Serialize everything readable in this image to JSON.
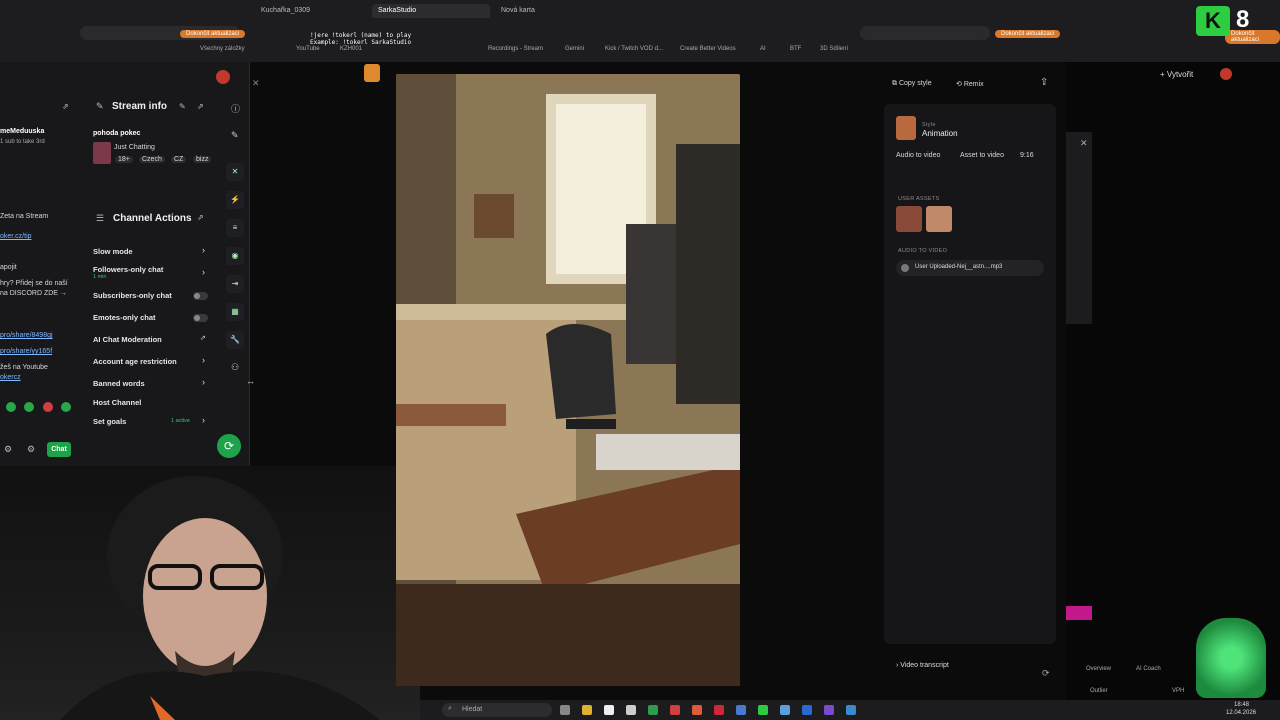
{
  "browser": {
    "tabs": [
      "Kuchařka_0309",
      "SarkaStudio",
      "Nová karta"
    ],
    "stream_overlay_line1": "!jere !tokerl (name) to play",
    "stream_overlay_line2": "Example: !tokerl SarkaStudio",
    "bookmarks": [
      "YouTube",
      "KZH001",
      "Gemini",
      "Recordings - Stream",
      "Kick / Twitch VOD d...",
      "Create Better Videos",
      "AI",
      "BTF",
      "3D Sdílení",
      "Všechny záložky"
    ],
    "update_label": "Dokončit aktualizaci",
    "profile_badge": "8"
  },
  "twitch": {
    "user_name": "meMeduuska",
    "sub_hint": "1 sub to take 3rd",
    "side_texts": [
      "Zeta na Stream",
      "oker.cz/tip",
      "apojit",
      "hry? Přidej se do naší",
      "na DISCORD ZDE →",
      "pro/share/8498gj",
      "pro/share/yy165f",
      "žeš na Youtube",
      "okercz"
    ],
    "stream_info": {
      "title": "Stream info",
      "stream_title": "pohoda pokec",
      "category": "Just Chatting",
      "tags": [
        "18+",
        "Czech",
        "CZ",
        "bizz"
      ]
    },
    "channel_actions": {
      "title": "Channel Actions",
      "items": [
        {
          "label": "Slow mode",
          "control": "chevron"
        },
        {
          "label": "Followers-only chat",
          "sub": "1 min",
          "control": "chevron"
        },
        {
          "label": "Subscribers-only chat",
          "control": "toggle"
        },
        {
          "label": "Emotes-only chat",
          "control": "toggle"
        },
        {
          "label": "AI Chat Moderation",
          "control": "external"
        },
        {
          "label": "Account age restriction",
          "control": "chevron"
        },
        {
          "label": "Banned words",
          "control": "chevron"
        },
        {
          "label": "Host Channel",
          "control": "none"
        },
        {
          "label": "Set goals",
          "sub": "1 active",
          "control": "chevron"
        }
      ]
    },
    "chat_button": "Chat"
  },
  "editor": {
    "copy_style": "Copy style",
    "remix": "Remix",
    "style_caption": "Style",
    "style_name": "Animation",
    "tags": [
      "Audio to video",
      "Asset to video",
      "9:16"
    ],
    "user_assets_caption": "USER ASSETS",
    "audio_caption": "AUDIO TO VIDEO",
    "audio_file": "User Uploaded-Nej__astn....mp3",
    "video_transcript": "Video transcript"
  },
  "right_stream": {
    "create_label": "Vytvořit",
    "tabs": [
      "Overview",
      "AI Coach"
    ],
    "sub_label": "Outlier",
    "vph": "VPH"
  },
  "taskbar": {
    "search_placeholder": "Hledat",
    "time": "18:48",
    "date": "12.04.2026"
  }
}
